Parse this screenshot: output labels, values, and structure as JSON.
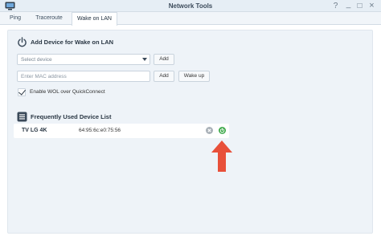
{
  "window": {
    "title": "Network Tools",
    "controls": {
      "help": "?",
      "minimize": "_",
      "maximize": "□",
      "close": "×"
    }
  },
  "tabs": [
    {
      "label": "Ping",
      "active": false
    },
    {
      "label": "Traceroute",
      "active": false
    },
    {
      "label": "Wake on LAN",
      "active": true
    }
  ],
  "add_section": {
    "icon": "power-icon",
    "title": "Add Device for Wake on LAN",
    "select": {
      "value": "Select device"
    },
    "add_label": "Add",
    "mac_input": {
      "placeholder": "Enter MAC address",
      "value": ""
    },
    "add_mac_label": "Add",
    "wake_up_label": "Wake up",
    "quickconnect": {
      "label": "Enable WOL over QuickConnect",
      "checked": true
    }
  },
  "list_section": {
    "icon": "list-icon",
    "title": "Frequently Used Device List",
    "devices": [
      {
        "name": "TV LG 4K",
        "mac": "64:95:6c:e0:75:56"
      }
    ]
  },
  "colors": {
    "accent_green": "#3da94a",
    "annotation_arrow": "#e8503a",
    "panel_bg": "#eef3f8"
  }
}
